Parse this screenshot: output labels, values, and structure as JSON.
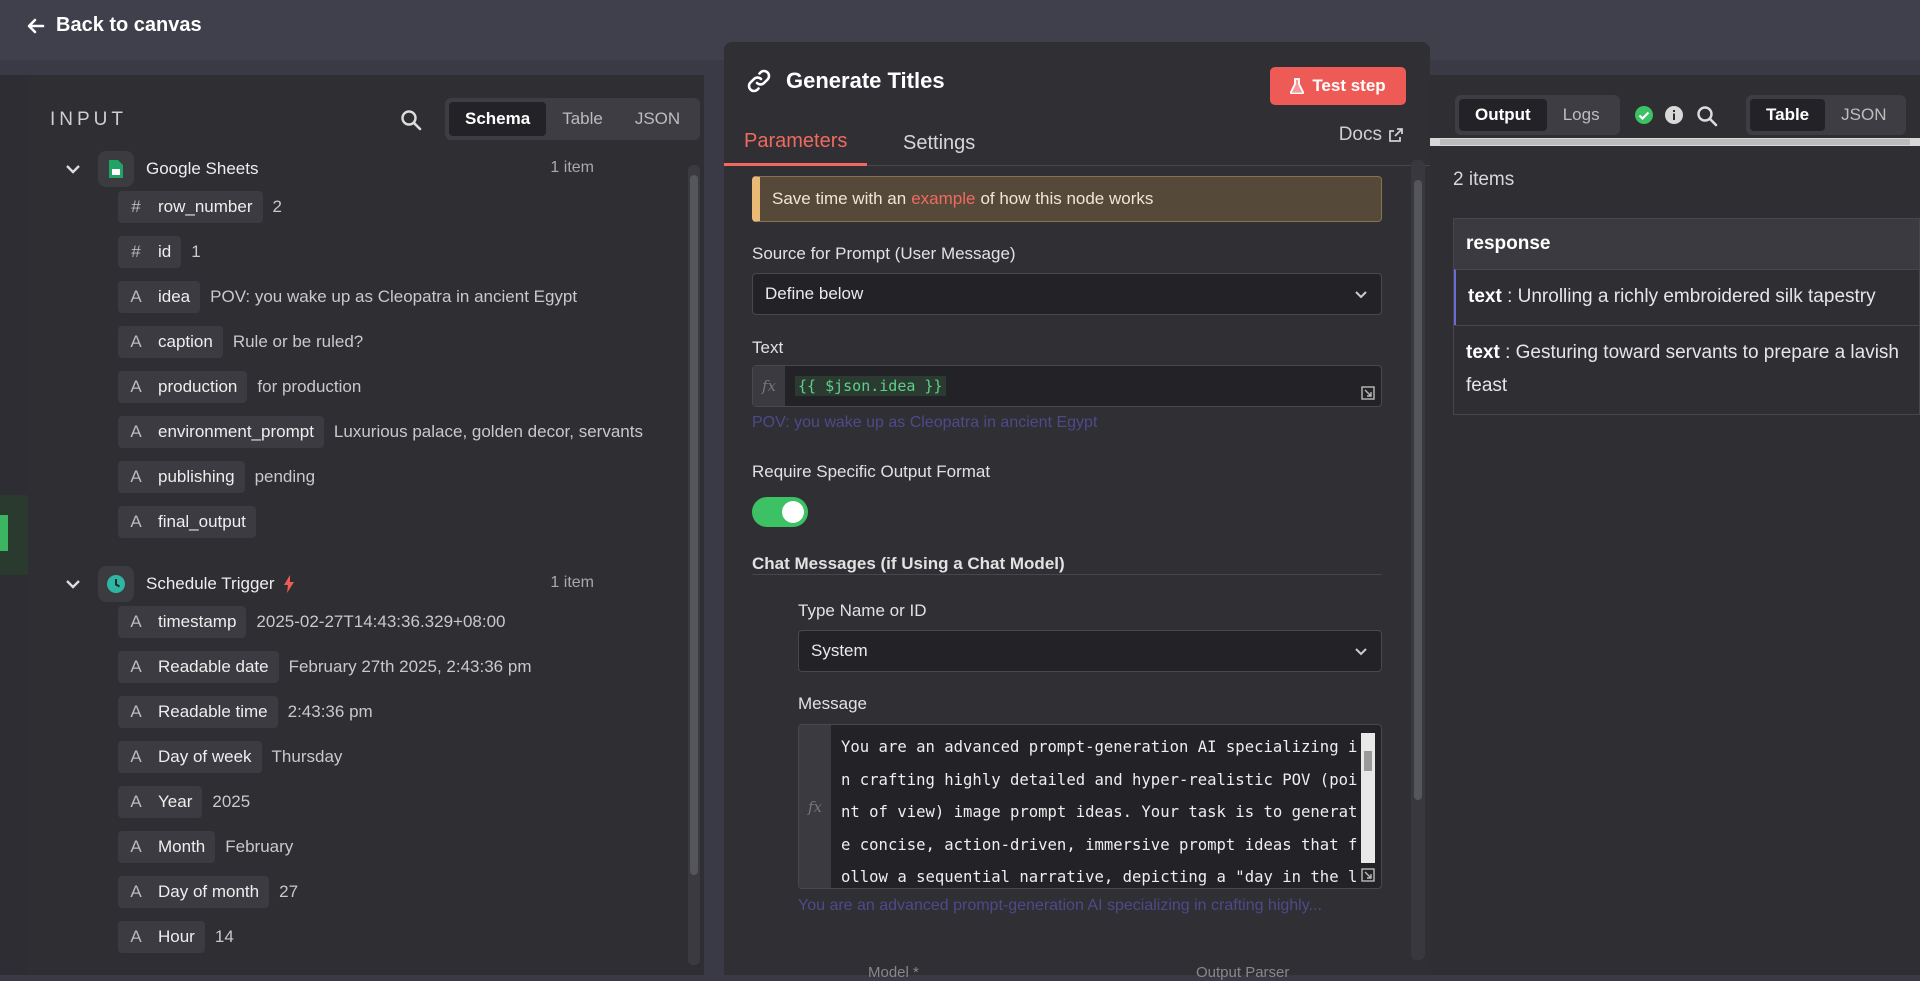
{
  "nav": {
    "back_label": "Back to canvas"
  },
  "input": {
    "title": "INPUT",
    "view_tabs": [
      "Schema",
      "Table",
      "JSON"
    ],
    "active_view": "Schema",
    "groups": [
      {
        "name": "Google Sheets",
        "count": "1 item",
        "fields": [
          {
            "type": "#",
            "name": "row_number",
            "value": "2"
          },
          {
            "type": "#",
            "name": "id",
            "value": "1"
          },
          {
            "type": "A",
            "name": "idea",
            "value": "POV: you wake up as Cleopatra in ancient Egypt"
          },
          {
            "type": "A",
            "name": "caption",
            "value": "Rule or be ruled?"
          },
          {
            "type": "A",
            "name": "production",
            "value": "for production"
          },
          {
            "type": "A",
            "name": "environment_prompt",
            "value": "Luxurious palace, golden decor, servants"
          },
          {
            "type": "A",
            "name": "publishing",
            "value": "pending"
          },
          {
            "type": "A",
            "name": "final_output",
            "value": ""
          }
        ]
      },
      {
        "name": "Schedule Trigger",
        "count": "1 item",
        "fields": [
          {
            "type": "A",
            "name": "timestamp",
            "value": "2025-02-27T14:43:36.329+08:00"
          },
          {
            "type": "A",
            "name": "Readable date",
            "value": "February 27th 2025, 2:43:36 pm"
          },
          {
            "type": "A",
            "name": "Readable time",
            "value": "2:43:36 pm"
          },
          {
            "type": "A",
            "name": "Day of week",
            "value": "Thursday"
          },
          {
            "type": "A",
            "name": "Year",
            "value": "2025"
          },
          {
            "type": "A",
            "name": "Month",
            "value": "February"
          },
          {
            "type": "A",
            "name": "Day of month",
            "value": "27"
          },
          {
            "type": "A",
            "name": "Hour",
            "value": "14"
          }
        ]
      }
    ]
  },
  "node": {
    "title": "Generate Titles",
    "test_step_label": "Test step",
    "tabs": {
      "parameters": "Parameters",
      "settings": "Settings"
    },
    "docs_label": "Docs",
    "notice": {
      "prefix": "Save time with an",
      "link": "example",
      "suffix": "of how this node works"
    },
    "source_label": "Source for Prompt (User Message)",
    "source_value": "Define below",
    "text_label": "Text",
    "text_expression": "{{ $json.idea }}",
    "text_preview": "POV: you wake up as Cleopatra in ancient Egypt",
    "require_format_label": "Require Specific Output Format",
    "require_format_on": true,
    "chat_messages_label": "Chat Messages (if Using a Chat Model)",
    "type_label": "Type Name or ID",
    "type_value": "System",
    "message_label": "Message",
    "message_text": "You are an advanced prompt-generation AI specializing in crafting highly detailed and hyper-realistic POV (point of view) image prompt ideas. Your task is to generate concise, action-driven, immersive prompt ideas that follow a sequential narrative, depicting a \"day in the life\" experience based on a given video topic.",
    "message_preview": "You are an advanced prompt-generation AI specializing in crafting highly...",
    "bottom_labels": [
      "Model *",
      "Output Parser"
    ]
  },
  "output": {
    "tabs": [
      "Output",
      "Logs"
    ],
    "active_tab": "Output",
    "view_tabs": [
      "Table",
      "JSON"
    ],
    "active_view": "Table",
    "items_label": "2 items",
    "column": "response",
    "rows": [
      {
        "key": "text",
        "value": "Unrolling a richly embroidered silk tapestry"
      },
      {
        "key": "text",
        "value": "Gesturing toward servants to prepare a lavish feast"
      }
    ]
  },
  "colors": {
    "accent": "#f06a5f",
    "success": "#3cc165",
    "panel": "#2e2e33"
  }
}
